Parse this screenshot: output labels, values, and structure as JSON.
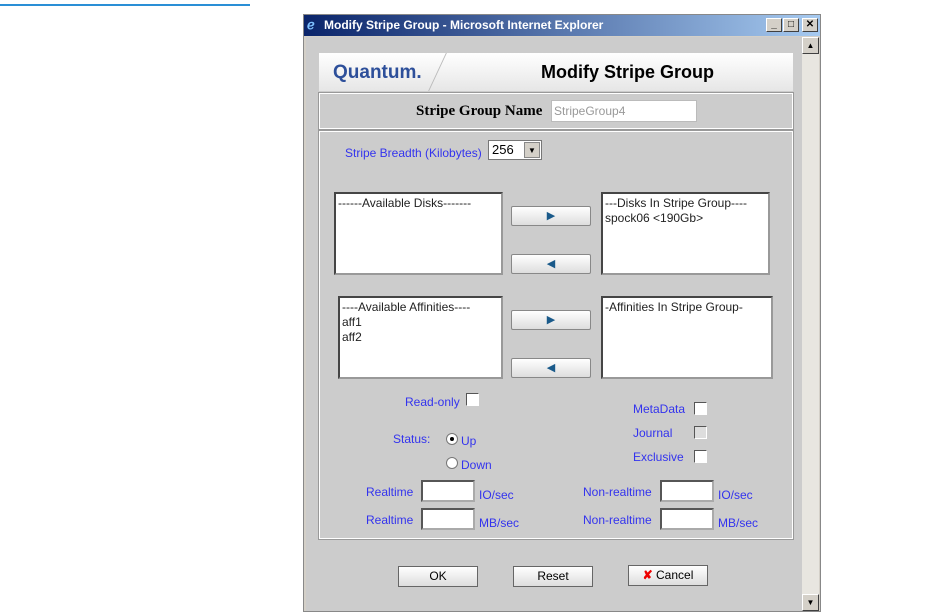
{
  "window": {
    "title": "Modify Stripe Group - Microsoft Internet Explorer"
  },
  "header": {
    "logo": "Quantum.",
    "title": "Modify Stripe Group"
  },
  "name": {
    "label": "Stripe Group Name",
    "value": "StripeGroup4"
  },
  "breadth": {
    "label": "Stripe Breadth (Kilobytes)",
    "value": "256"
  },
  "disks": {
    "available_header": "------Available Disks-------",
    "selected_header": "---Disks In Stripe Group----",
    "selected_items": [
      "spock06  <190Gb>"
    ]
  },
  "affinities": {
    "available_header": "----Available Affinities----",
    "available_items": [
      "aff1",
      "aff2"
    ],
    "selected_header": "-Affinities In Stripe Group-"
  },
  "options": {
    "readonly": "Read-only",
    "metadata": "MetaData",
    "journal": "Journal",
    "exclusive": "Exclusive",
    "status": "Status:",
    "up": "Up",
    "down": "Down"
  },
  "qos": {
    "realtime": "Realtime",
    "nonrealtime": "Non-realtime",
    "io": "IO/sec",
    "mb": "MB/sec"
  },
  "buttons": {
    "ok": "OK",
    "reset": "Reset",
    "cancel": "Cancel"
  }
}
